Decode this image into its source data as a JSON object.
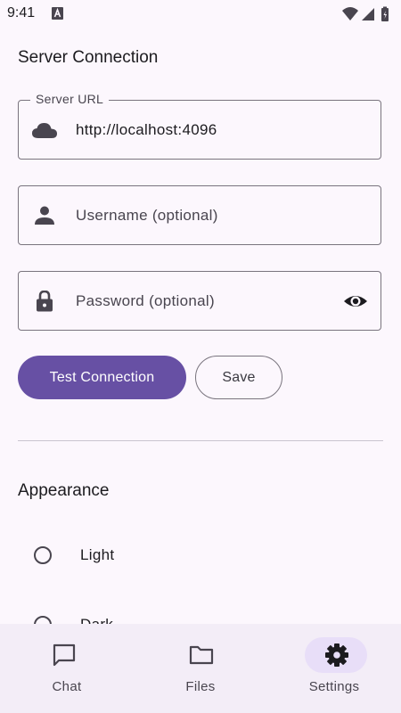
{
  "status_bar": {
    "time": "9:41"
  },
  "server_section": {
    "title": "Server Connection",
    "url_field": {
      "label": "Server URL",
      "value": "http://localhost:4096",
      "icon": "cloud-icon"
    },
    "username_field": {
      "placeholder": "Username (optional)",
      "icon": "person-icon"
    },
    "password_field": {
      "placeholder": "Password (optional)",
      "icon": "lock-icon",
      "trailing_icon": "eye-icon"
    },
    "test_button_label": "Test Connection",
    "save_button_label": "Save"
  },
  "appearance_section": {
    "title": "Appearance",
    "options": [
      {
        "label": "Light",
        "selected": false
      },
      {
        "label": "Dark",
        "selected": false
      }
    ]
  },
  "bottom_nav": {
    "items": [
      {
        "label": "Chat",
        "icon": "chat-icon",
        "active": false
      },
      {
        "label": "Files",
        "icon": "folder-icon",
        "active": false
      },
      {
        "label": "Settings",
        "icon": "gear-icon",
        "active": true
      }
    ]
  },
  "colors": {
    "background": "#fcf7fd",
    "primary": "#6750a4",
    "outline": "#79747e",
    "nav_background": "#f3edf7",
    "nav_active_pill": "#e8def8"
  }
}
